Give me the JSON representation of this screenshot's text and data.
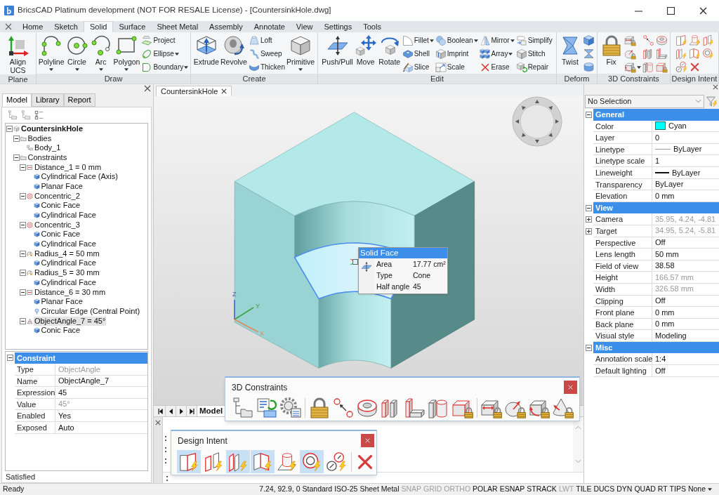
{
  "window": {
    "title": "BricsCAD Platinum development (NOT FOR RESALE License) - [CountersinkHole.dwg]"
  },
  "ribbon": {
    "tabs": [
      {
        "label": "Home",
        "selected": false
      },
      {
        "label": "Sketch",
        "selected": false
      },
      {
        "label": "Solid",
        "selected": true
      },
      {
        "label": "Surface",
        "selected": false
      },
      {
        "label": "Sheet Metal",
        "selected": false
      },
      {
        "label": "Assembly",
        "selected": false
      },
      {
        "label": "Annotate",
        "selected": false
      },
      {
        "label": "View",
        "selected": false
      },
      {
        "label": "Settings",
        "selected": false
      },
      {
        "label": "Tools",
        "selected": false
      }
    ],
    "panels": [
      {
        "title": "Plane",
        "tools": [
          {
            "label": "Align UCS",
            "kind": "large",
            "dropdown": false
          }
        ]
      },
      {
        "title": "Draw",
        "tools": [
          {
            "label": "Polyline",
            "kind": "large",
            "dropdown": true
          },
          {
            "label": "Circle",
            "kind": "large",
            "dropdown": true
          },
          {
            "label": "Arc",
            "kind": "large",
            "dropdown": true
          },
          {
            "label": "Polygon",
            "kind": "large",
            "dropdown": true
          },
          {
            "label": "Project",
            "kind": "small",
            "dropdown": false
          },
          {
            "label": "Ellipse",
            "kind": "small",
            "dropdown": true
          },
          {
            "label": "Boundary",
            "kind": "small",
            "dropdown": true
          }
        ]
      },
      {
        "title": "Create",
        "tools": [
          {
            "label": "Extrude",
            "kind": "large",
            "dropdown": false
          },
          {
            "label": "Revolve",
            "kind": "large",
            "dropdown": false
          },
          {
            "label": "Loft",
            "kind": "small",
            "dropdown": false
          },
          {
            "label": "Sweep",
            "kind": "small",
            "dropdown": false
          },
          {
            "label": "Thicken",
            "kind": "small",
            "dropdown": false
          },
          {
            "label": "Primitive",
            "kind": "large",
            "dropdown": true
          }
        ]
      },
      {
        "title": "Edit",
        "tools": [
          {
            "label": "Push/Pull",
            "kind": "large",
            "dropdown": false
          },
          {
            "label": "Move",
            "kind": "large",
            "dropdown": false
          },
          {
            "label": "Rotate",
            "kind": "large",
            "dropdown": false
          },
          {
            "label": "Fillet",
            "kind": "small",
            "dropdown": true
          },
          {
            "label": "Shell",
            "kind": "small",
            "dropdown": false
          },
          {
            "label": "Slice",
            "kind": "small",
            "dropdown": false
          },
          {
            "label": "Boolean",
            "kind": "small",
            "dropdown": true
          },
          {
            "label": "Imprint",
            "kind": "small",
            "dropdown": false
          },
          {
            "label": "Scale",
            "kind": "small",
            "dropdown": false
          },
          {
            "label": "Mirror",
            "kind": "small",
            "dropdown": true
          },
          {
            "label": "Array",
            "kind": "small",
            "dropdown": true
          },
          {
            "label": "Erase",
            "kind": "small",
            "dropdown": false
          },
          {
            "label": "Simplify",
            "kind": "small",
            "dropdown": false
          },
          {
            "label": "Stitch",
            "kind": "small",
            "dropdown": false
          },
          {
            "label": "Repair",
            "kind": "small",
            "dropdown": false
          }
        ]
      },
      {
        "title": "Deform",
        "tools": [
          {
            "label": "Twist",
            "kind": "large",
            "dropdown": false
          },
          {
            "kind": "icon",
            "dropdown": false
          },
          {
            "kind": "icon",
            "dropdown": false
          },
          {
            "kind": "icon",
            "dropdown": false
          }
        ]
      },
      {
        "title": "3D Constraints",
        "tools": [
          {
            "label": "Fix",
            "kind": "large",
            "dropdown": false
          },
          {
            "kind": "icon",
            "dropdown": false
          },
          {
            "kind": "icon",
            "dropdown": false
          },
          {
            "kind": "icon",
            "dropdown": true
          },
          {
            "kind": "icon",
            "dropdown": false
          },
          {
            "kind": "icon",
            "dropdown": false
          },
          {
            "kind": "icon",
            "dropdown": false
          },
          {
            "kind": "icon",
            "dropdown": false
          },
          {
            "kind": "icon",
            "dropdown": false
          },
          {
            "kind": "icon",
            "dropdown": false
          }
        ]
      },
      {
        "title": "Design Intent",
        "tools": [
          {
            "kind": "icon",
            "dropdown": false
          },
          {
            "kind": "icon",
            "dropdown": false
          },
          {
            "kind": "icon",
            "dropdown": false
          },
          {
            "kind": "icon",
            "dropdown": false
          },
          {
            "kind": "icon",
            "dropdown": false
          },
          {
            "kind": "icon",
            "dropdown": false
          },
          {
            "kind": "icon",
            "dropdown": false
          },
          {
            "kind": "icon",
            "dropdown": false
          }
        ]
      }
    ]
  },
  "model_panel": {
    "tabs": [
      {
        "label": "Model",
        "selected": true
      },
      {
        "label": "Library",
        "selected": false
      },
      {
        "label": "Report",
        "selected": false
      }
    ],
    "tree": [
      {
        "label": "CountersinkHole",
        "kind": "part",
        "expanded": true,
        "selected": false,
        "children": [
          {
            "label": "Bodies",
            "kind": "folder",
            "expanded": true,
            "selected": false,
            "children": [
              {
                "label": "Body_1",
                "kind": "body",
                "selected": false
              }
            ]
          },
          {
            "label": "Constraints",
            "kind": "folder",
            "expanded": true,
            "selected": false,
            "children": [
              {
                "label": "Distance_1 = 0 mm",
                "kind": "distance",
                "expanded": true,
                "selected": false,
                "children": [
                  {
                    "label": "Cylindrical Face (Axis)",
                    "kind": "face",
                    "selected": false
                  },
                  {
                    "label": "Planar Face",
                    "kind": "face",
                    "selected": false
                  }
                ]
              },
              {
                "label": "Concentric_2",
                "kind": "concentric",
                "expanded": true,
                "selected": false,
                "children": [
                  {
                    "label": "Conic Face",
                    "kind": "face",
                    "selected": false
                  },
                  {
                    "label": "Cylindrical Face",
                    "kind": "face",
                    "selected": false
                  }
                ]
              },
              {
                "label": "Concentric_3",
                "kind": "concentric",
                "expanded": true,
                "selected": false,
                "children": [
                  {
                    "label": "Conic Face",
                    "kind": "face",
                    "selected": false
                  },
                  {
                    "label": "Cylindrical Face",
                    "kind": "face",
                    "selected": false
                  }
                ]
              },
              {
                "label": "Radius_4 = 50 mm",
                "kind": "radius",
                "expanded": true,
                "selected": false,
                "children": [
                  {
                    "label": "Cylindrical Face",
                    "kind": "face",
                    "selected": false
                  }
                ]
              },
              {
                "label": "Radius_5 = 30 mm",
                "kind": "radius",
                "expanded": true,
                "selected": false,
                "children": [
                  {
                    "label": "Cylindrical Face",
                    "kind": "face",
                    "selected": false
                  }
                ]
              },
              {
                "label": "Distance_6 = 30 mm",
                "kind": "distance",
                "expanded": true,
                "selected": false,
                "children": [
                  {
                    "label": "Planar Face",
                    "kind": "face",
                    "selected": false
                  },
                  {
                    "label": "Circular Edge (Central Point)",
                    "kind": "edge",
                    "selected": false
                  }
                ]
              },
              {
                "label": "ObjectAngle_7 = 45°",
                "kind": "angle",
                "expanded": true,
                "selected": true,
                "children": [
                  {
                    "label": "Conic Face",
                    "kind": "face",
                    "selected": false
                  }
                ]
              }
            ]
          }
        ]
      }
    ],
    "properties": {
      "title": "Constraint",
      "expanded": true,
      "rows": [
        {
          "label": "Type",
          "value": "ObjectAngle",
          "disabled": true
        },
        {
          "label": "Name",
          "value": "ObjectAngle_7",
          "disabled": false
        },
        {
          "label": "Expression",
          "value": "45",
          "disabled": false
        },
        {
          "label": "Value",
          "value": "45°",
          "disabled": true
        },
        {
          "label": "Enabled",
          "value": "Yes",
          "disabled": false
        },
        {
          "label": "Exposed",
          "value": "Auto",
          "disabled": false
        }
      ]
    },
    "status": "Satisfied"
  },
  "viewport": {
    "tab": "CountersinkHole",
    "axis_labels": [
      "Z",
      "Y",
      "X"
    ],
    "tooltip": {
      "title": "Solid Face",
      "rows": [
        {
          "label": "Area",
          "value": "17.77 cm²"
        },
        {
          "label": "Type",
          "value": "Cone"
        },
        {
          "label": "Half angle",
          "value": "45"
        }
      ]
    },
    "layout_tabs": [
      {
        "label": "Model",
        "selected": true
      }
    ]
  },
  "properties_panel": {
    "selection": "No Selection",
    "sections": [
      {
        "title": "General",
        "expanded": true,
        "rows": [
          {
            "label": "Color",
            "value": "Cyan",
            "kind": "swatch",
            "color": "#00ffff",
            "disabled": false
          },
          {
            "label": "Layer",
            "value": "0",
            "kind": "text",
            "disabled": false
          },
          {
            "label": "Linetype",
            "value": "ByLayer",
            "kind": "hairline",
            "disabled": false
          },
          {
            "label": "Linetype scale",
            "value": "1",
            "kind": "text",
            "disabled": false
          },
          {
            "label": "Lineweight",
            "value": "ByLayer",
            "kind": "thickline",
            "disabled": false
          },
          {
            "label": "Transparency",
            "value": "ByLayer",
            "kind": "text",
            "disabled": false
          },
          {
            "label": "Elevation",
            "value": "0 mm",
            "kind": "text",
            "disabled": false
          }
        ]
      },
      {
        "title": "View",
        "expanded": true,
        "rows": [
          {
            "label": "Camera",
            "value": "35.95, 4.24, -4.81",
            "kind": "text",
            "disabled": true,
            "expanded": false
          },
          {
            "label": "Target",
            "value": "34.95, 5.24, -5.81",
            "kind": "text",
            "disabled": true,
            "expanded": false
          },
          {
            "label": "Perspective",
            "value": "Off",
            "kind": "text",
            "disabled": false
          },
          {
            "label": "Lens length",
            "value": "50 mm",
            "kind": "text",
            "disabled": false
          },
          {
            "label": "Field of view",
            "value": "38.58",
            "kind": "text",
            "disabled": false
          },
          {
            "label": "Height",
            "value": "166.57 mm",
            "kind": "text",
            "disabled": true
          },
          {
            "label": "Width",
            "value": "326.58 mm",
            "kind": "text",
            "disabled": true
          },
          {
            "label": "Clipping",
            "value": "Off",
            "kind": "text",
            "disabled": false
          },
          {
            "label": "Front plane",
            "value": "0 mm",
            "kind": "text",
            "disabled": false
          },
          {
            "label": "Back plane",
            "value": "0 mm",
            "kind": "text",
            "disabled": false
          },
          {
            "label": "Visual style",
            "value": "Modeling",
            "kind": "text",
            "disabled": false
          }
        ]
      },
      {
        "title": "Misc",
        "expanded": true,
        "rows": [
          {
            "label": "Annotation scale",
            "value": "1:4",
            "kind": "text",
            "disabled": false
          },
          {
            "label": "Default lighting",
            "value": "Off",
            "kind": "text",
            "disabled": false
          }
        ]
      }
    ]
  },
  "constraints_toolbar": {
    "title": "3D Constraints"
  },
  "design_intent_toolbar": {
    "title": "Design Intent",
    "toggles": [
      {
        "selected": true
      },
      {
        "selected": false
      },
      {
        "selected": true
      },
      {
        "selected": true
      },
      {
        "selected": false
      },
      {
        "selected": true
      },
      {
        "selected": false
      }
    ]
  },
  "command_line": {
    "history": [
      ":",
      ":",
      ":"
    ],
    "prompt": ":"
  },
  "status_bar": {
    "message": "Ready",
    "coordinates": "7.24, 92.9, 0",
    "fields": [
      "Standard",
      "ISO-25",
      "Sheet Metal"
    ],
    "toggles": [
      {
        "label": "SNAP",
        "on": false
      },
      {
        "label": "GRID",
        "on": false
      },
      {
        "label": "ORTHO",
        "on": false
      },
      {
        "label": "POLAR",
        "on": true
      },
      {
        "label": "ESNAP",
        "on": true
      },
      {
        "label": "STRACK",
        "on": true
      },
      {
        "label": "LWT",
        "on": false
      },
      {
        "label": "TILE",
        "on": true
      },
      {
        "label": "DUCS",
        "on": true
      },
      {
        "label": "DYN",
        "on": true
      },
      {
        "label": "QUAD",
        "on": true
      },
      {
        "label": "RT",
        "on": true
      },
      {
        "label": "TIPS",
        "on": true
      }
    ],
    "snap_mode": "None"
  }
}
